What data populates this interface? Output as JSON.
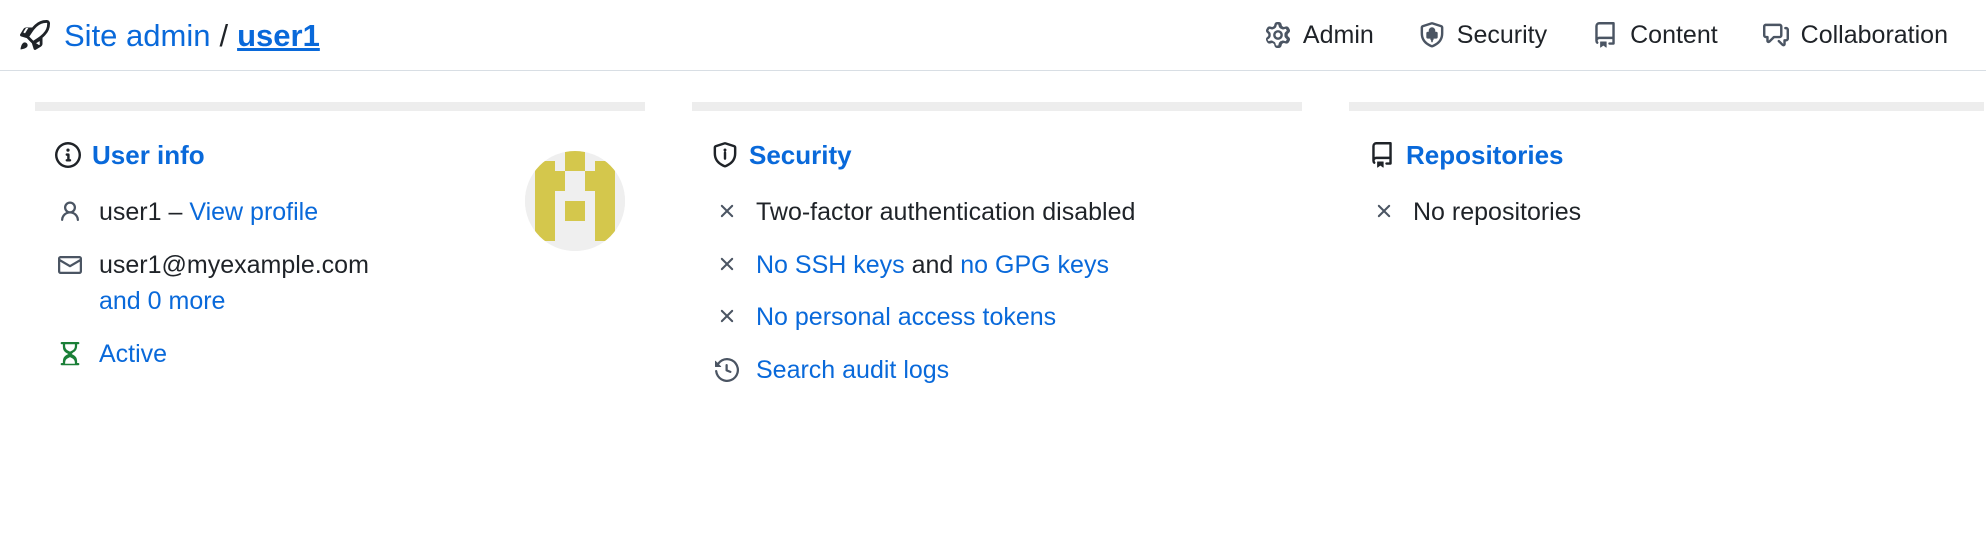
{
  "header": {
    "rocket_icon": "rocket-icon",
    "breadcrumb_root": "Site admin",
    "breadcrumb_separator": "/",
    "breadcrumb_current": "user1",
    "nav": [
      {
        "label": "Admin",
        "icon": "gear-icon"
      },
      {
        "label": "Security",
        "icon": "shield-lock-icon"
      },
      {
        "label": "Content",
        "icon": "book-icon"
      },
      {
        "label": "Collaboration",
        "icon": "comment-discussion-icon"
      }
    ]
  },
  "cards": {
    "user_info": {
      "title": "User info",
      "title_icon": "info-icon",
      "rows": {
        "username": {
          "icon": "person-icon",
          "name": "user1",
          "dash": "–",
          "link": "View profile"
        },
        "email": {
          "icon": "mail-icon",
          "value": "user1@myexample.com",
          "more_link": "and 0 more"
        },
        "status": {
          "icon": "hourglass-icon",
          "label": "Active"
        }
      },
      "avatar": {
        "name": "user-avatar",
        "background": "#efefef",
        "foreground": "#d4c74c"
      }
    },
    "security": {
      "title": "Security",
      "title_icon": "shield-lock-icon",
      "rows": [
        {
          "icon": "x-icon",
          "text": "Two-factor authentication disabled",
          "link": false
        },
        {
          "icon": "x-icon",
          "link_1": "No SSH keys",
          "middle": " and ",
          "link_2": "no GPG keys"
        },
        {
          "icon": "x-icon",
          "text": "No personal access tokens",
          "link": true
        },
        {
          "icon": "history-icon",
          "text": "Search audit logs",
          "link": true
        }
      ]
    },
    "repositories": {
      "title": "Repositories",
      "title_icon": "repo-icon",
      "rows": [
        {
          "icon": "x-icon",
          "text": "No repositories"
        }
      ]
    }
  },
  "colors": {
    "link": "#0969da",
    "text": "#1f2328",
    "muted_icon": "#4b5563",
    "success": "#1a7f37",
    "card_header": "#ededed",
    "border": "#d8dee4"
  }
}
